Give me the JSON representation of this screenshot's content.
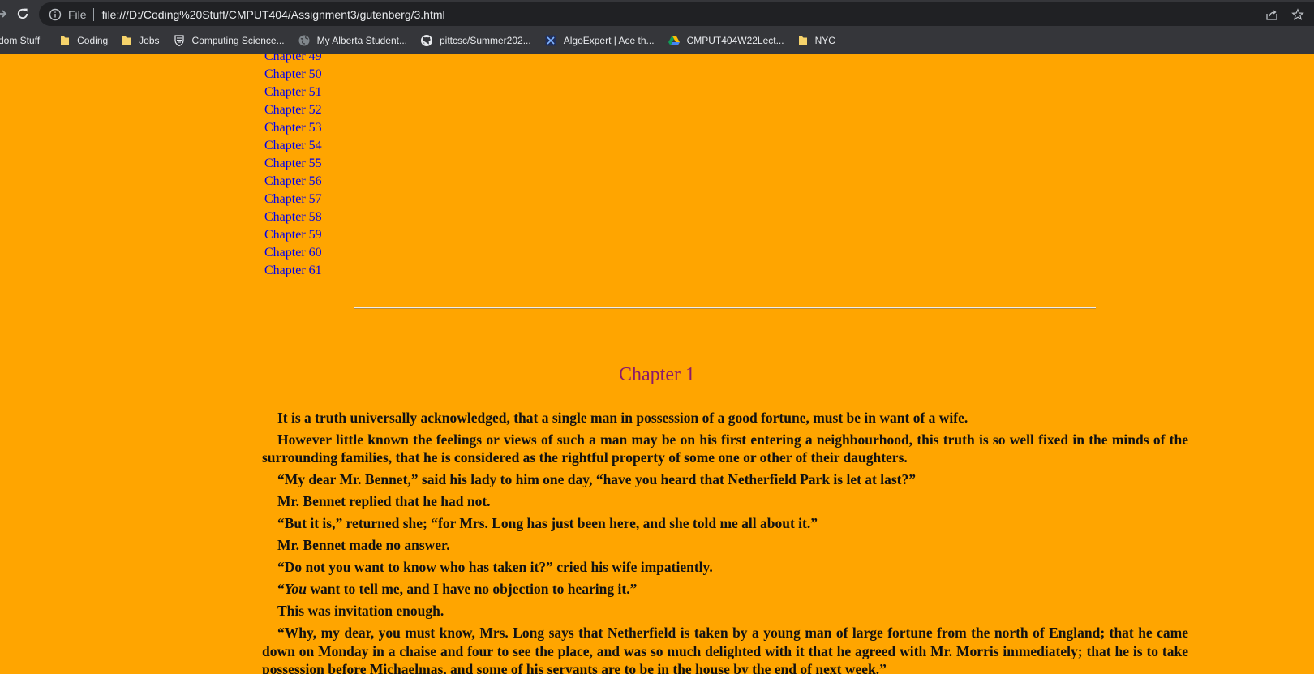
{
  "browser": {
    "scheme_label": "File",
    "url": "file:///D:/Coding%20Stuff/CMPUT404/Assignment3/gutenberg/3.html",
    "bookmarks": [
      {
        "label": "dom Stuff",
        "icon": "folder-icon"
      },
      {
        "label": "Coding",
        "icon": "folder-icon"
      },
      {
        "label": "Jobs",
        "icon": "folder-icon"
      },
      {
        "label": "Computing Science...",
        "icon": "uofa-shield-icon"
      },
      {
        "label": "My Alberta Student...",
        "icon": "globe-icon"
      },
      {
        "label": "pittcsc/Summer202...",
        "icon": "github-icon"
      },
      {
        "label": "AlgoExpert | Ace th...",
        "icon": "algoexpert-icon"
      },
      {
        "label": "CMPUT404W22Lect...",
        "icon": "google-drive-icon"
      },
      {
        "label": "NYC",
        "icon": "folder-icon"
      }
    ]
  },
  "toc": {
    "chapters": [
      "Chapter 49",
      "Chapter 50",
      "Chapter 51",
      "Chapter 52",
      "Chapter 53",
      "Chapter 54",
      "Chapter 55",
      "Chapter 56",
      "Chapter 57",
      "Chapter 58",
      "Chapter 59",
      "Chapter 60",
      "Chapter 61"
    ]
  },
  "chapter": {
    "title": "Chapter 1",
    "paragraphs": [
      "It is a truth universally acknowledged, that a single man in possession of a good fortune, must be in want of a wife.",
      "However little known the feelings or views of such a man may be on his first entering a neighbourhood, this truth is so well fixed in the minds of the surrounding families, that he is considered as the rightful property of some one or other of their daughters.",
      "“My dear Mr. Bennet,” said his lady to him one day, “have you heard that Netherfield Park is let at last?”",
      "Mr. Bennet replied that he had not.",
      "“But it is,” returned she; “for Mrs. Long has just been here, and she told me all about it.”",
      "Mr. Bennet made no answer.",
      "“Do not you want to know who has taken it?” cried his wife impatiently.",
      {
        "open": "“",
        "em": "You",
        "rest": " want to tell me, and I have no objection to hearing it.”"
      },
      "This was invitation enough.",
      "“Why, my dear, you must know, Mrs. Long says that Netherfield is taken by a young man of large fortune from the north of England; that he came down on Monday in a chaise and four to see the place, and was so much delighted with it that he agreed with Mr. Morris immediately; that he is to take possession before Michaelmas, and some of his servants are to be in the house by the end of next week.”"
    ]
  },
  "colors": {
    "page_background": "#ffa500",
    "link": "#0000ee",
    "chapter_heading": "#8b1a6b",
    "chrome_background": "#35363a",
    "omnibox_background": "#202124"
  }
}
